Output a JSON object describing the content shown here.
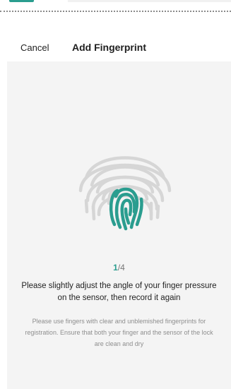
{
  "header": {
    "cancel_label": "Cancel",
    "title": "Add Fingerprint"
  },
  "progress": {
    "current": "1",
    "total": "/4"
  },
  "instruction": "Please slightly adjust the angle of your finger pressure on the sensor, then record it again",
  "tip": "Please use fingers with clear and unblemished fingerprints for registration. Ensure that both your finger and the sensor of the lock are clean and dry",
  "icons": {
    "fingerprint": "fingerprint-icon"
  },
  "colors": {
    "accent": "#2a9d8f",
    "panel_background": "#f4f4f4",
    "fingerprint_inactive": "#d6d6d6"
  }
}
